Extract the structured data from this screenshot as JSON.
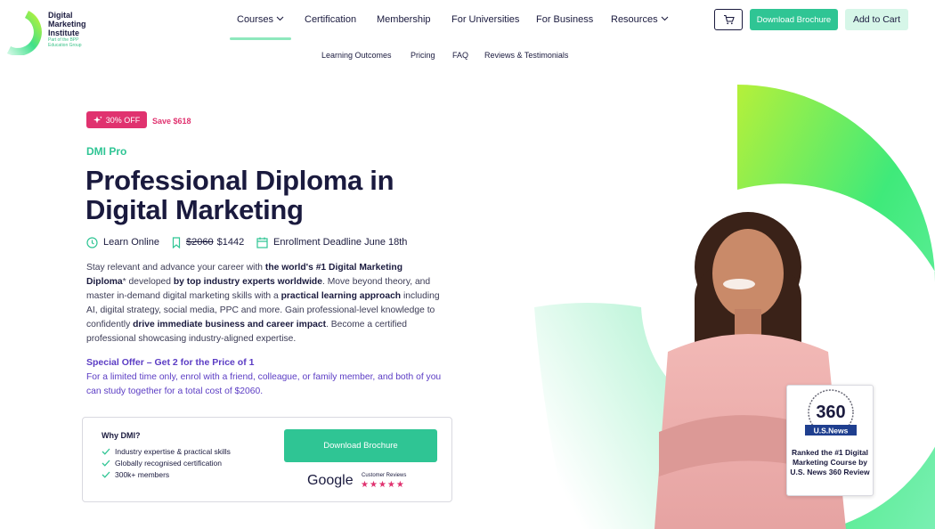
{
  "brand": {
    "name_lines": [
      "Digital",
      "Marketing",
      "Institute"
    ],
    "sub": "Part of the BPP Education Group",
    "accent": "#2fc594",
    "pink": "#e0326f",
    "purple": "#5b3cc4"
  },
  "nav": {
    "items": [
      {
        "label": "Courses",
        "has_menu": true,
        "active": true
      },
      {
        "label": "Certification",
        "has_menu": false
      },
      {
        "label": "Membership",
        "has_menu": false
      },
      {
        "label": "For Universities",
        "has_menu": false
      },
      {
        "label": "For Business",
        "has_menu": false
      },
      {
        "label": "Resources",
        "has_menu": true
      }
    ],
    "sub_items": [
      "Learning Outcomes",
      "Pricing",
      "FAQ",
      "Reviews & Testimonials"
    ],
    "cart_icon": "cart-icon",
    "download_label": "Download Brochure",
    "add_to_cart_label": "Add to Cart"
  },
  "hero": {
    "discount_badge": "30% OFF",
    "save_text": "Save $618",
    "eyebrow": "DMI Pro",
    "title": "Professional Diploma in Digital Marketing",
    "meta": {
      "mode": "Learn Online",
      "old_price": "$2060",
      "price": "$1442",
      "deadline": "Enrollment Deadline June 18th"
    },
    "description": {
      "p1": "Stay relevant and advance your career with ",
      "b1": "the world's #1 Digital Marketing Diploma",
      "p2": "* developed ",
      "b2": "by top industry experts worldwide",
      "p3": ". Move beyond theory, and master in-demand digital marketing skills with a ",
      "b3": "practical learning approach",
      "p4": " including AI, digital strategy, social media, PPC and more. Gain professional-level knowledge to confidently ",
      "b4": "drive immediate business and career impact",
      "p5": ". Become a certified professional showcasing industry-aligned expertise."
    },
    "offer_title": "Special Offer – Get 2 for the Price of 1",
    "offer_text": "For a limited time only, enrol with a friend, colleague, or family member, and both of you can study together for a total cost of $2060."
  },
  "why": {
    "title": "Why DMI?",
    "items": [
      "Industry expertise & practical skills",
      "Globally recognised certification",
      "300k+ members"
    ],
    "cta": "Download Brochure",
    "google": "Google",
    "reviews_label": "Customer Reviews",
    "rating_stars": 5
  },
  "award": {
    "badge_number": "360",
    "badge_brand": "U.S.News",
    "text": "Ranked the #1 Digital Marketing Course by U.S. News 360 Review"
  }
}
